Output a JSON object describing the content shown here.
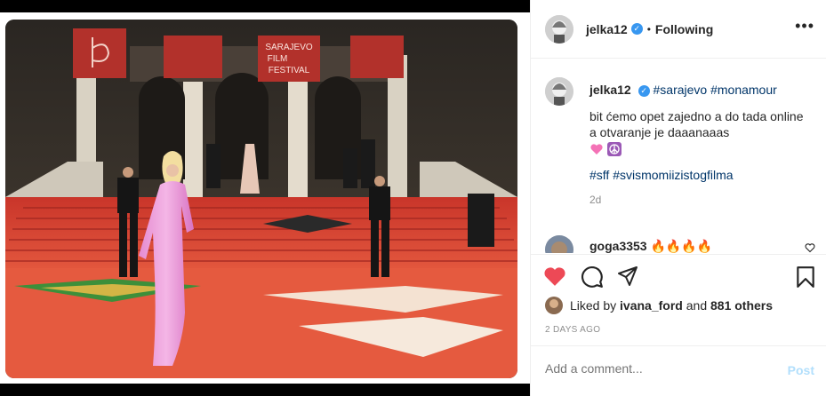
{
  "photo": {
    "banner_text": [
      "SARAJEVO",
      "FILM",
      "FESTIVAL"
    ],
    "alt": "Woman in pink dress on red carpet"
  },
  "header": {
    "username": "jelka12",
    "dot": "•",
    "follow_status": "Following",
    "more_label": "•••"
  },
  "caption": {
    "username": "jelka12",
    "hashtags_top": "#sarajevo #monamour",
    "line1": "bit ćemo opet zajedno a do tada online",
    "line2": "a otvaranje je daaanaaas",
    "hashtags_bottom": "#sff #svismomiizistogfilma",
    "time_ago": "2d"
  },
  "comment2": {
    "username": "goga3353",
    "text": "🔥🔥🔥🔥"
  },
  "likes": {
    "prefix": "Liked by",
    "user": "ivana_ford",
    "middle": "and",
    "others": "881 others"
  },
  "date_text": "2 DAYS AGO",
  "add_comment": {
    "placeholder": "Add a comment...",
    "post_label": "Post"
  },
  "colors": {
    "like_red": "#ed4956",
    "link_blue": "#003569",
    "verified_blue": "#3897f0",
    "post_disabled": "#b2dffc"
  },
  "icons": [
    "heart-icon",
    "comment-icon",
    "share-icon",
    "bookmark-icon",
    "verified-icon",
    "more-icon"
  ]
}
